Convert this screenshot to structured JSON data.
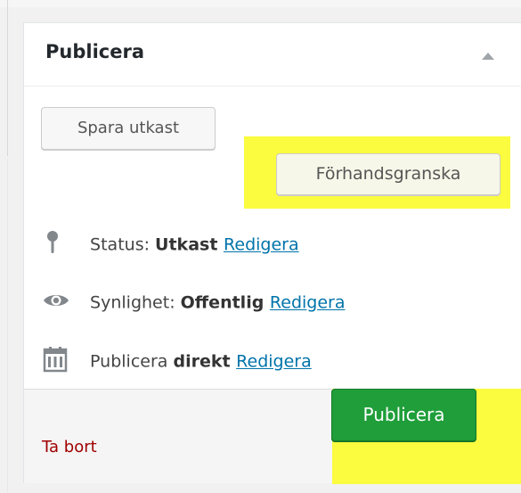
{
  "panel": {
    "title": "Publicera"
  },
  "actions": {
    "save_draft_label": "Spara utkast",
    "preview_label": "Förhandsgranska"
  },
  "misc": {
    "status": {
      "label": "Status:",
      "value": "Utkast",
      "edit_label": "Redigera",
      "icon": "pin-icon"
    },
    "visibility": {
      "label": "Synlighet:",
      "value": "Offentlig",
      "edit_label": "Redigera",
      "icon": "eye-icon"
    },
    "schedule": {
      "label": "Publicera",
      "value": "direkt",
      "edit_label": "Redigera",
      "icon": "calendar-icon"
    }
  },
  "footer": {
    "delete_label": "Ta bort",
    "publish_label": "Publicera"
  },
  "colors": {
    "highlight": "#fbfb3f",
    "publish_button": "#1f9e3a",
    "link": "#0073aa",
    "delete_link": "#a00000"
  }
}
